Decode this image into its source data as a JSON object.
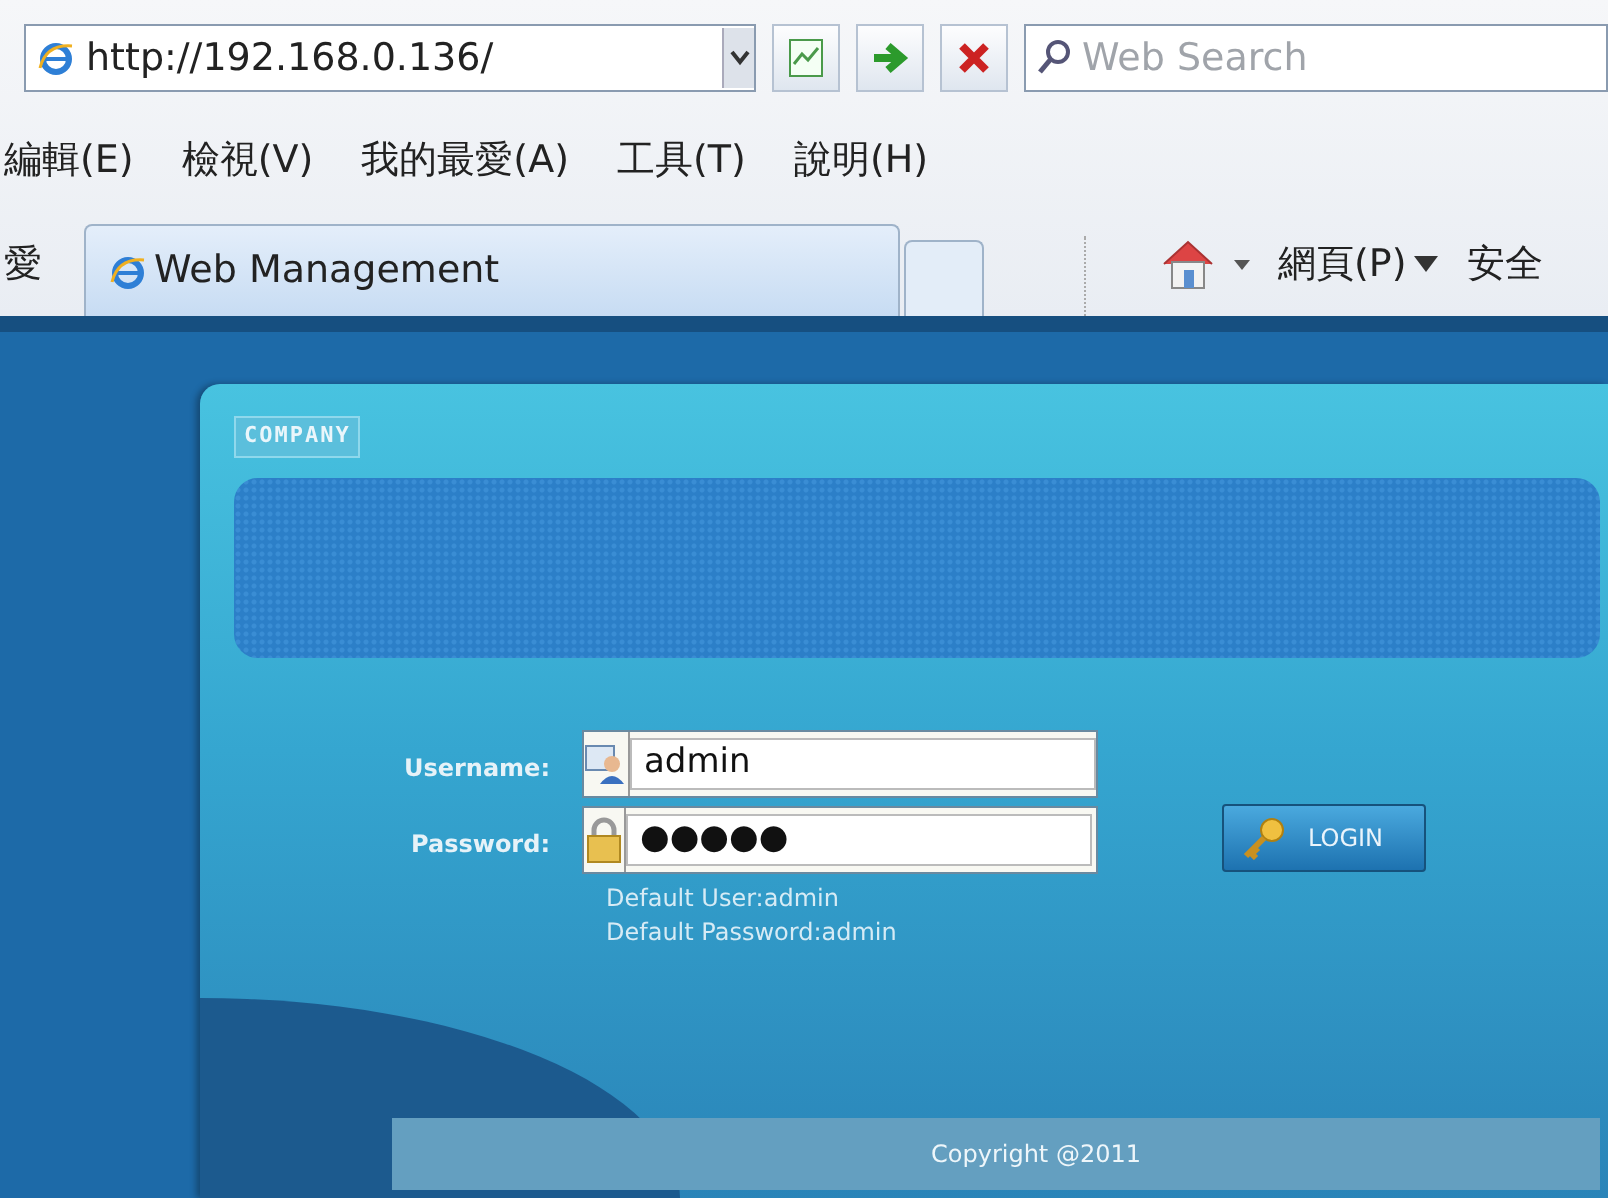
{
  "browser": {
    "address": "http://192.168.0.136/",
    "search": {
      "placeholder": "Web Search"
    },
    "menu": [
      "編輯(E)",
      "檢視(V)",
      "我的最愛(A)",
      "工具(T)",
      "說明(H)"
    ],
    "favorites_cut": "愛",
    "tabs": [
      {
        "label": "Web Management",
        "selected": true
      }
    ],
    "commands": [
      {
        "label": "網頁(P)",
        "dropdown": true
      },
      {
        "label": "安全",
        "dropdown": false
      }
    ]
  },
  "page": {
    "company_label": "COMPANY",
    "fields": [
      {
        "label": "Username:",
        "value": "admin",
        "kind": "user"
      },
      {
        "label": "Password:",
        "value": "●●●●●",
        "kind": "lock"
      }
    ],
    "hints": [
      "Default User:admin",
      "Default Password:admin"
    ],
    "login_button": "LOGIN",
    "footer": "Copyright @2011"
  }
}
